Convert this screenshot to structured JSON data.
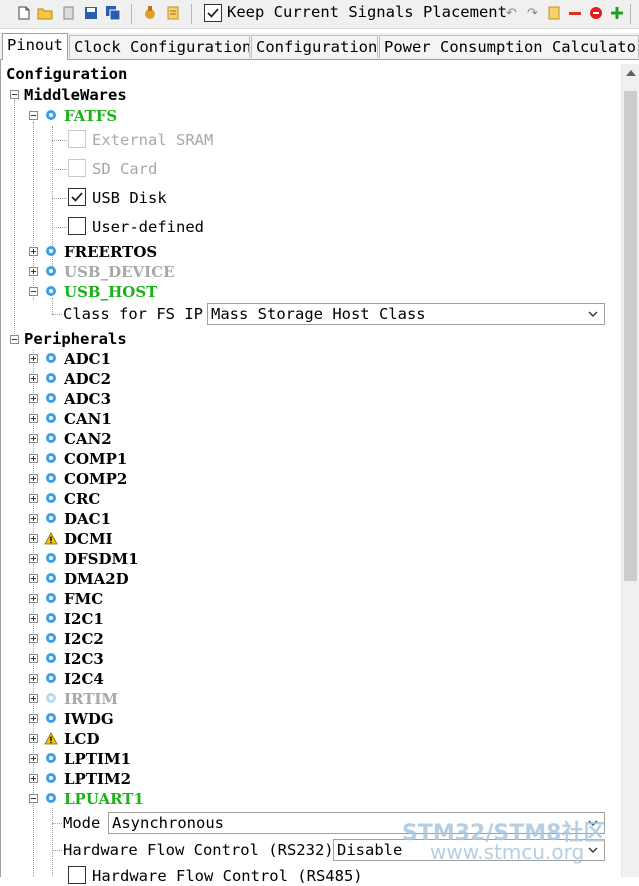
{
  "toolbar": {
    "keep_signals_label": "Keep Current Signals Placement",
    "keep_signals_checked": true
  },
  "tabs": [
    {
      "label": "Pinout",
      "active": true
    },
    {
      "label": "Clock Configuration",
      "active": false
    },
    {
      "label": "Configuration",
      "active": false
    },
    {
      "label": "Power Consumption Calculator",
      "active": false
    }
  ],
  "tree": {
    "root_label": "Configuration",
    "middlewares": {
      "label": "MiddleWares",
      "fatfs": {
        "label": "FATFS",
        "options": [
          {
            "label": "External SRAM",
            "checked": false,
            "enabled": false
          },
          {
            "label": "SD Card",
            "checked": false,
            "enabled": false
          },
          {
            "label": "USB Disk",
            "checked": true,
            "enabled": true
          },
          {
            "label": "User-defined",
            "checked": false,
            "enabled": true
          }
        ]
      },
      "freertos": {
        "label": "FREERTOS"
      },
      "usb_device": {
        "label": "USB_DEVICE"
      },
      "usb_host": {
        "label": "USB_HOST",
        "class_label": "Class for FS IP",
        "class_value": "Mass Storage Host Class"
      }
    },
    "peripherals": {
      "label": "Peripherals",
      "items": [
        {
          "label": "ADC1",
          "state": "normal"
        },
        {
          "label": "ADC2",
          "state": "normal"
        },
        {
          "label": "ADC3",
          "state": "normal"
        },
        {
          "label": "CAN1",
          "state": "normal"
        },
        {
          "label": "CAN2",
          "state": "normal"
        },
        {
          "label": "COMP1",
          "state": "normal"
        },
        {
          "label": "COMP2",
          "state": "normal"
        },
        {
          "label": "CRC",
          "state": "normal"
        },
        {
          "label": "DAC1",
          "state": "normal"
        },
        {
          "label": "DCMI",
          "state": "warning"
        },
        {
          "label": "DFSDM1",
          "state": "normal"
        },
        {
          "label": "DMA2D",
          "state": "normal"
        },
        {
          "label": "FMC",
          "state": "normal"
        },
        {
          "label": "I2C1",
          "state": "normal"
        },
        {
          "label": "I2C2",
          "state": "normal"
        },
        {
          "label": "I2C3",
          "state": "normal"
        },
        {
          "label": "I2C4",
          "state": "normal"
        },
        {
          "label": "IRTIM",
          "state": "disabled"
        },
        {
          "label": "IWDG",
          "state": "normal"
        },
        {
          "label": "LCD",
          "state": "warning"
        },
        {
          "label": "LPTIM1",
          "state": "normal"
        },
        {
          "label": "LPTIM2",
          "state": "normal"
        },
        {
          "label": "LPUART1",
          "state": "active"
        }
      ],
      "lpuart1": {
        "mode_label": "Mode",
        "mode_value": "Asynchronous",
        "hwflow_label": "Hardware Flow Control (RS232)",
        "hwflow_value": "Disable",
        "rs485_label": "Hardware Flow Control (RS485)"
      }
    }
  },
  "watermark": {
    "line1": "STM32/STM8社区",
    "line2": "www.stmcu.org"
  },
  "colors": {
    "active_green": "#19b319",
    "disabled_gray": "#a8a8a8",
    "gear_blue": "#3aa0e0",
    "warning_yellow": "#f2c200"
  }
}
